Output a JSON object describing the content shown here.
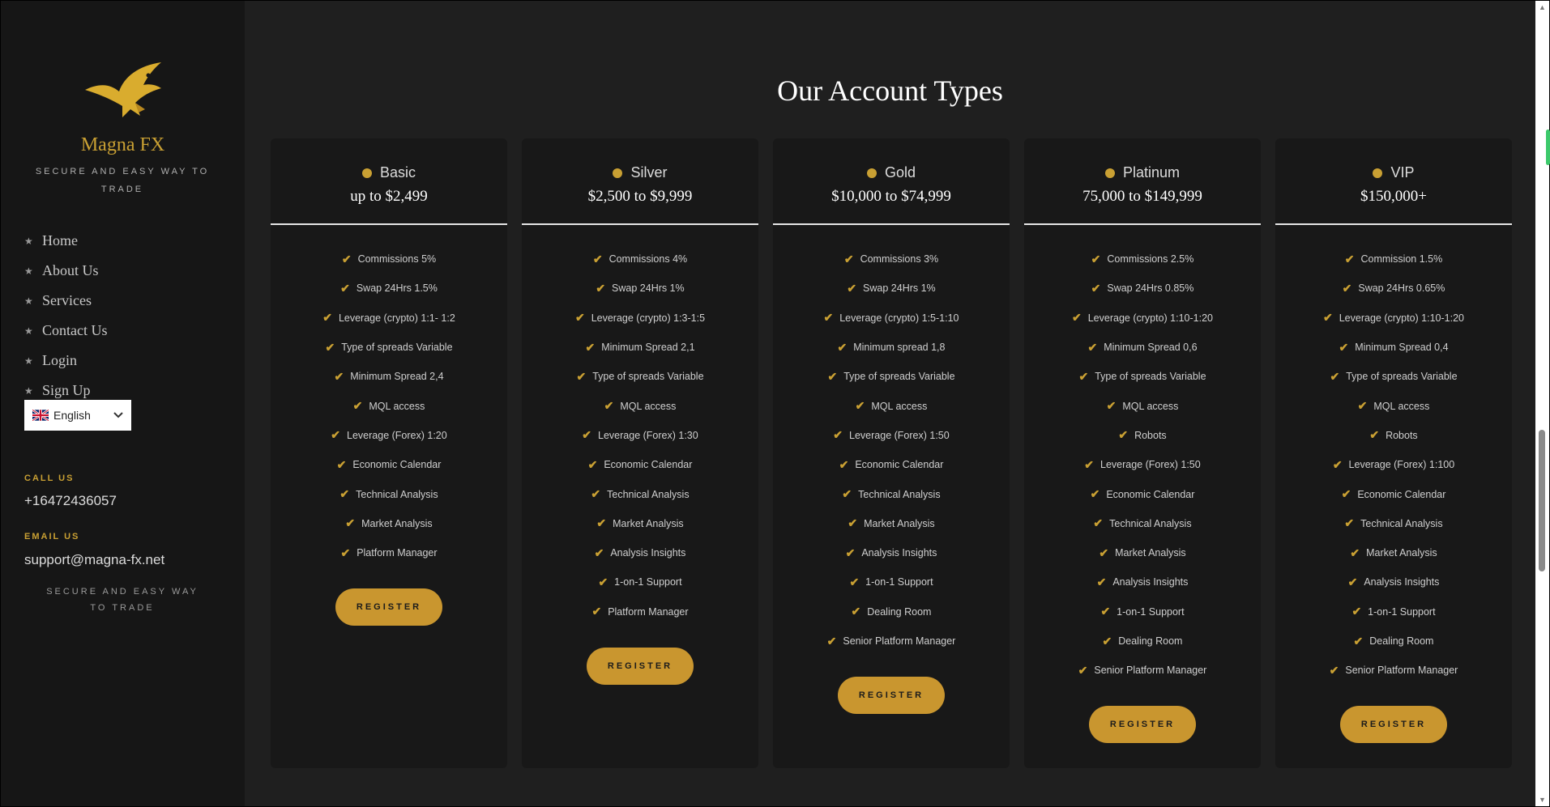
{
  "brand": {
    "name": "Magna FX",
    "tagline": "SECURE AND EASY WAY TO TRADE"
  },
  "nav": [
    "Home",
    "About Us",
    "Services",
    "Contact Us",
    "Login",
    "Sign Up"
  ],
  "language": {
    "selected": "English"
  },
  "contact": {
    "call_label": "CALL US",
    "phone": "+16472436057",
    "email_label": "EMAIL US",
    "email": "support@magna-fx.net",
    "tagline": "SECURE AND EASY WAY TO TRADE"
  },
  "page": {
    "title": "Our Account Types",
    "register_label": "REGISTER"
  },
  "plans": [
    {
      "name": "Basic",
      "price": "up to $2,499",
      "features": [
        "Commissions 5%",
        "Swap 24Hrs 1.5%",
        "Leverage (crypto) 1:1- 1:2",
        "Type of spreads Variable",
        "Minimum Spread 2,4",
        "MQL access",
        "Leverage (Forex) 1:20",
        "Economic Calendar",
        "Technical Analysis",
        "Market Analysis",
        "Platform Manager"
      ]
    },
    {
      "name": "Silver",
      "price": "$2,500 to $9,999",
      "features": [
        "Commissions 4%",
        "Swap 24Hrs 1%",
        "Leverage (crypto) 1:3-1:5",
        "Minimum Spread 2,1",
        "Type of spreads Variable",
        "MQL access",
        "Leverage (Forex) 1:30",
        "Economic Calendar",
        "Technical Analysis",
        "Market Analysis",
        "Analysis Insights",
        "1-on-1 Support",
        "Platform Manager"
      ]
    },
    {
      "name": "Gold",
      "price": "$10,000 to $74,999",
      "features": [
        "Commissions 3%",
        "Swap 24Hrs 1%",
        "Leverage (crypto) 1:5-1:10",
        "Minimum spread 1,8",
        "Type of spreads Variable",
        "MQL access",
        "Leverage (Forex) 1:50",
        "Economic Calendar",
        "Technical Analysis",
        "Market Analysis",
        "Analysis Insights",
        "1-on-1 Support",
        "Dealing Room",
        "Senior Platform Manager"
      ]
    },
    {
      "name": "Platinum",
      "price": "75,000 to $149,999",
      "features": [
        "Commissions 2.5%",
        "Swap 24Hrs 0.85%",
        "Leverage (crypto) 1:10-1:20",
        "Minimum Spread 0,6",
        "Type of spreads Variable",
        "MQL access",
        "Robots",
        "Leverage (Forex) 1:50",
        "Economic Calendar",
        "Technical Analysis",
        "Market Analysis",
        "Analysis Insights",
        "1-on-1 Support",
        "Dealing Room",
        "Senior Platform Manager"
      ]
    },
    {
      "name": "VIP",
      "price": "$150,000+",
      "features": [
        "Commission 1.5%",
        "Swap 24Hrs 0.65%",
        "Leverage (crypto) 1:10-1:20",
        "Minimum Spread 0,4",
        "Type of spreads Variable",
        "MQL access",
        "Robots",
        "Leverage (Forex) 1:100",
        "Economic Calendar",
        "Technical Analysis",
        "Market Analysis",
        "Analysis Insights",
        "1-on-1 Support",
        "Dealing Room",
        "Senior Platform Manager"
      ]
    }
  ],
  "colors": {
    "accent": "#c9a033",
    "button": "#c9962f",
    "sidebar": "#161616",
    "card": "#181818",
    "background": "#1f1f1f"
  }
}
